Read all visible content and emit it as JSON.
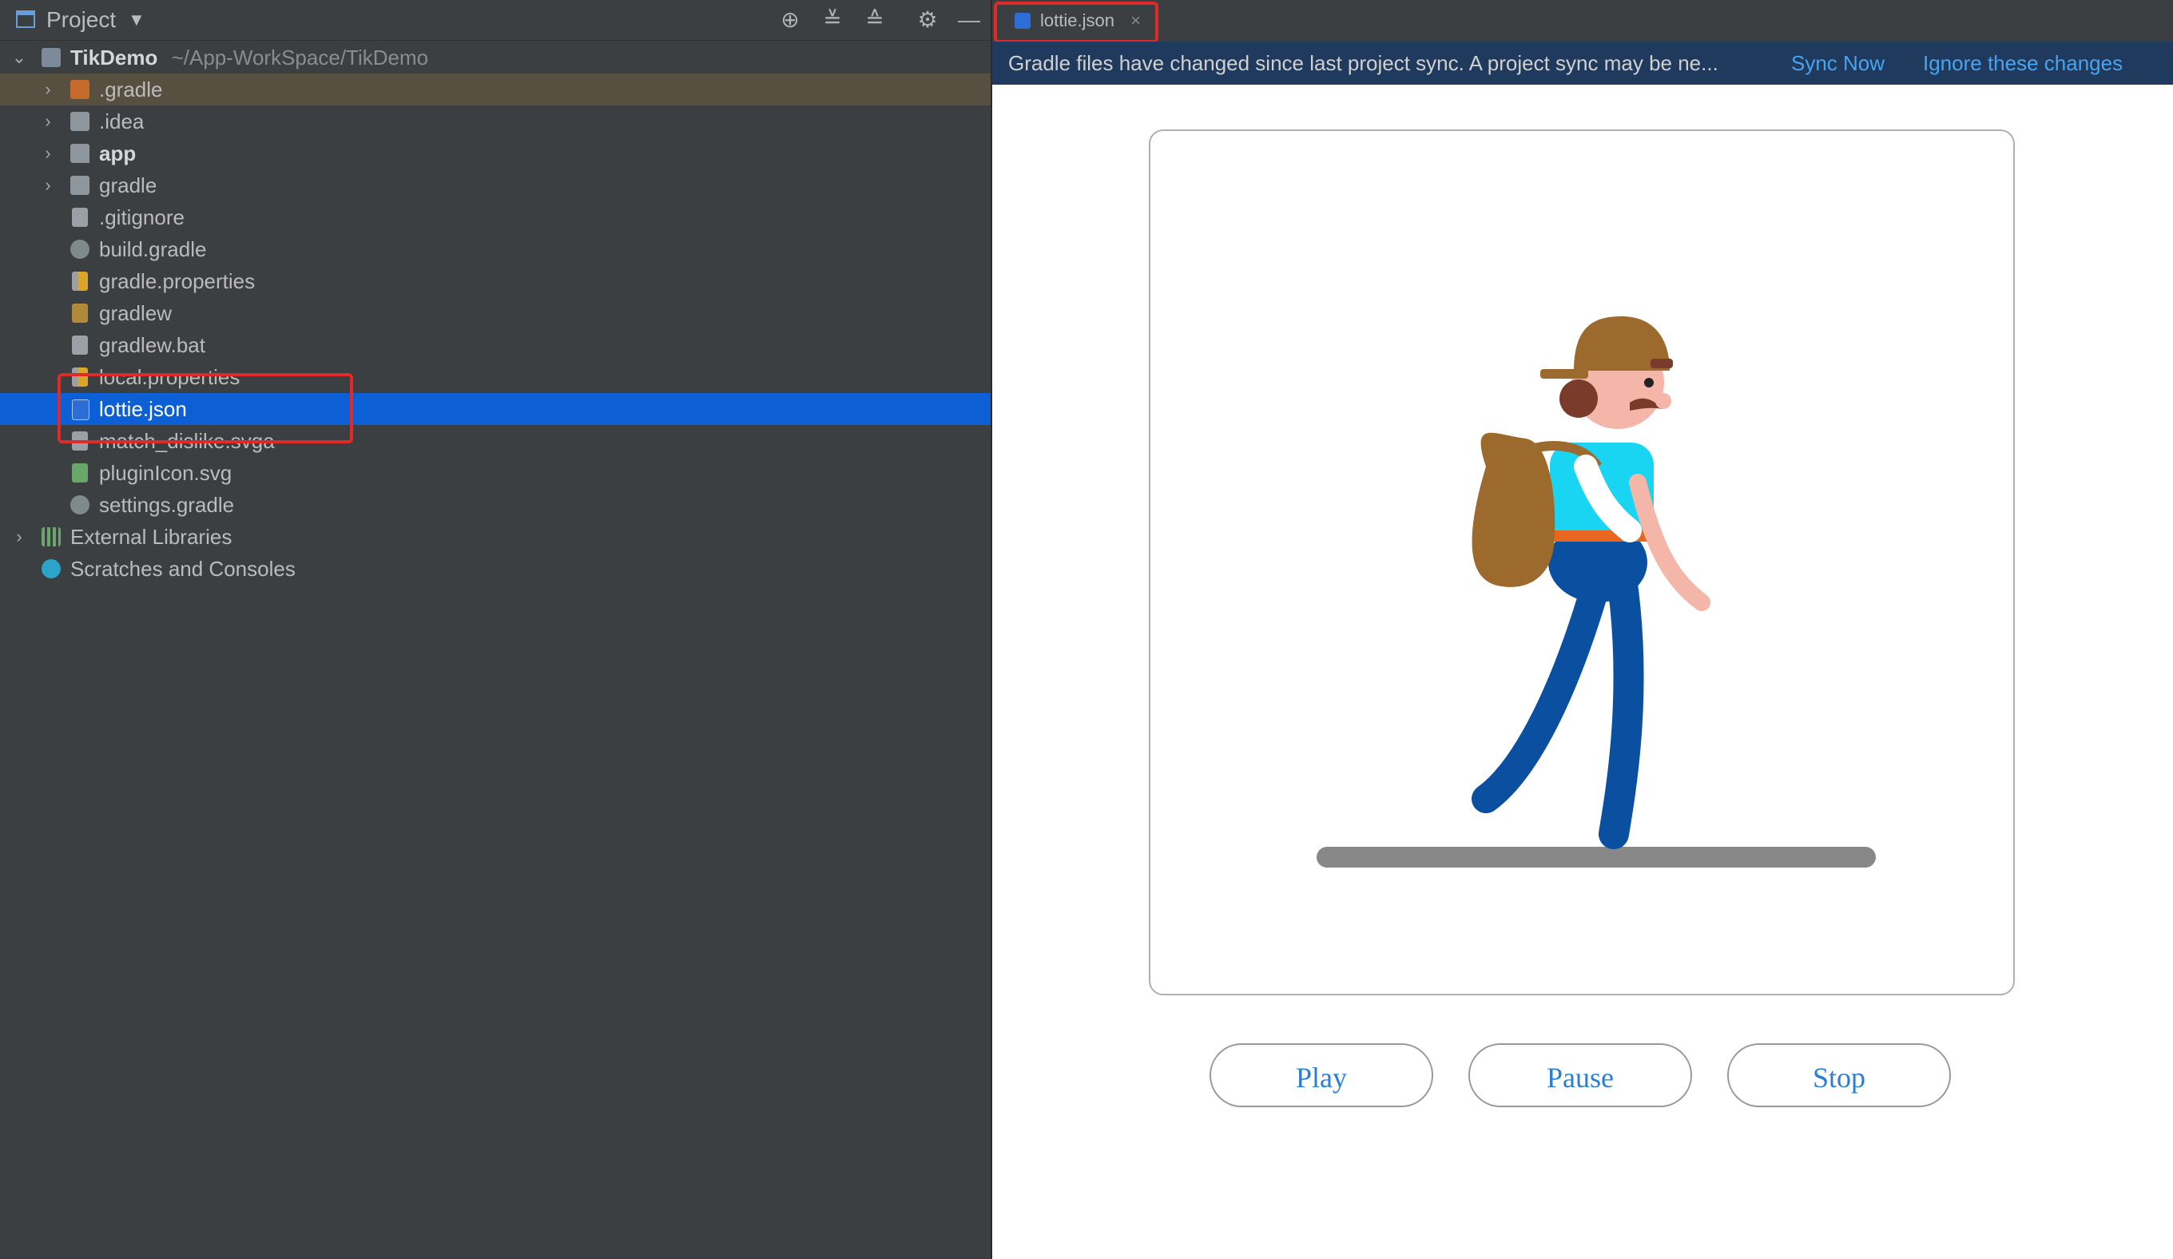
{
  "project_panel": {
    "title": "Project",
    "header_icons": [
      "locate-icon",
      "expand-all-icon",
      "collapse-all-icon",
      "gear-icon",
      "minimize-icon"
    ],
    "root": {
      "name": "TikDemo",
      "path": "~/App-WorkSpace/TikDemo"
    },
    "items": [
      {
        "label": ".gradle",
        "kind": "folder-orange"
      },
      {
        "label": ".idea",
        "kind": "folder"
      },
      {
        "label": "app",
        "kind": "module"
      },
      {
        "label": "gradle",
        "kind": "folder"
      },
      {
        "label": ".gitignore",
        "kind": "file-gitignore"
      },
      {
        "label": "build.gradle",
        "kind": "file-gradle"
      },
      {
        "label": "gradle.properties",
        "kind": "file-properties"
      },
      {
        "label": "gradlew",
        "kind": "file-exec"
      },
      {
        "label": "gradlew.bat",
        "kind": "file-text"
      },
      {
        "label": "local.properties",
        "kind": "file-properties"
      },
      {
        "label": "lottie.json",
        "kind": "file-json"
      },
      {
        "label": "match_dislike.svga",
        "kind": "file-text"
      },
      {
        "label": "pluginIcon.svg",
        "kind": "file-svg"
      },
      {
        "label": "settings.gradle",
        "kind": "file-gradle"
      }
    ],
    "external_libraries": "External Libraries",
    "scratches": "Scratches and Consoles"
  },
  "editor": {
    "tab_label": "lottie.json",
    "tab_close": "×",
    "banner": {
      "message": "Gradle files have changed since last project sync. A project sync may be ne...",
      "sync_now": "Sync Now",
      "ignore": "Ignore these changes"
    },
    "buttons": {
      "play": "Play",
      "pause": "Pause",
      "stop": "Stop"
    }
  },
  "colors": {
    "selection": "#0d5fd6",
    "highlight_box": "#e02a2a",
    "link": "#4aa3f0",
    "button_text": "#2a7fd4"
  }
}
